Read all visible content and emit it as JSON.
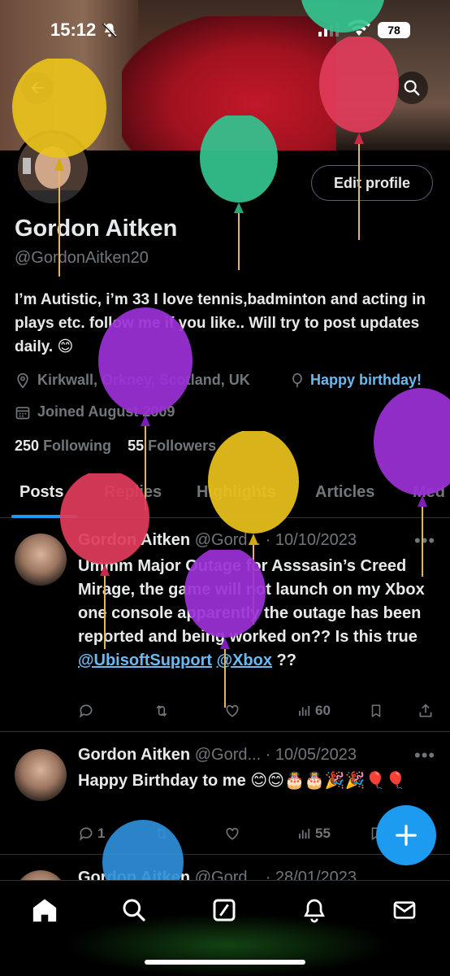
{
  "status_bar": {
    "time": "15:12",
    "battery": "78"
  },
  "profile": {
    "name": "Gordon Aitken",
    "handle": "@GordonAitken20",
    "bio": "I’m Autistic, i’m 33 I love tennis,badminton and acting in plays etc. follow me if you like.. Will try to post updates daily. 😊",
    "location": "Kirkwall, Orkney, Scotland, UK",
    "birthday": "Happy birthday!",
    "joined": "Joined August 2009",
    "following_count": "250",
    "following_label": "Following",
    "followers_count": "55",
    "followers_label": "Followers",
    "edit_label": "Edit profile"
  },
  "tabs": [
    {
      "label": "Posts"
    },
    {
      "label": "Replies"
    },
    {
      "label": "Highlights"
    },
    {
      "label": "Articles"
    },
    {
      "label": "Med"
    }
  ],
  "posts": [
    {
      "name": "Gordon Aitken",
      "handle": "@Gord...",
      "date": "· 10/10/2023",
      "text": "Ummm Major Outage for Asssasin’s Creed Mirage, the game will not launch on my Xbox one console apparently the outage has been reported and being worked on?? Is this true",
      "mention1": "@UbisoftSupport",
      "mention2": "@Xbox",
      "suffix": " ??",
      "views": "60"
    },
    {
      "name": "Gordon Aitken",
      "handle": "@Gord...",
      "date": "· 10/05/2023",
      "text": "Happy Birthday to me 😊😊🎂🎂🎉🎉🎈🎈",
      "replies": "1",
      "views": "55"
    },
    {
      "name": "Gordon Aitken",
      "handle": "@Gord...",
      "date": "· 28/01/2023"
    }
  ],
  "colors": {
    "accent": "#1d9bf0",
    "link": "#6cb9f0",
    "muted": "#71767b",
    "text": "#e7e9ea"
  }
}
